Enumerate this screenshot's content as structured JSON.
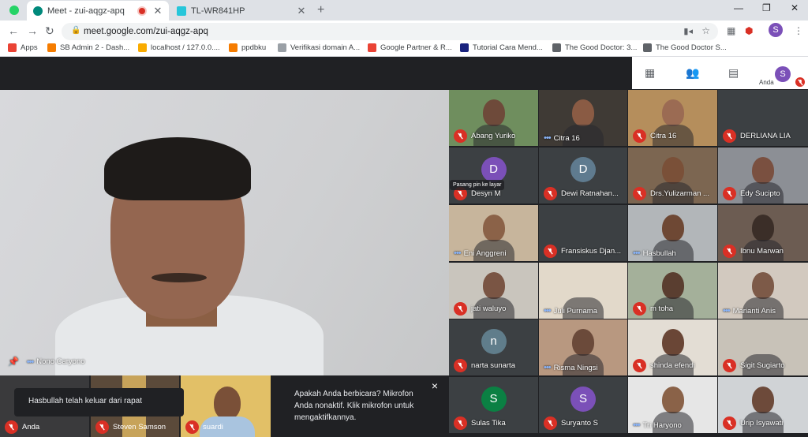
{
  "tabs": [
    {
      "title": "Meet - zui-aqgz-apq",
      "active": true,
      "favicon": "#00897b"
    },
    {
      "title": "TL-WR841HP",
      "active": false,
      "favicon": "#26c6da"
    }
  ],
  "address": {
    "url": "meet.google.com/zui-aqgz-apq"
  },
  "profile_initial": "S",
  "bookmarks": [
    {
      "label": "Apps",
      "color": "#ea4335"
    },
    {
      "label": "SB Admin 2 - Dash...",
      "color": "#f57c00"
    },
    {
      "label": "localhost / 127.0.0....",
      "color": "#f9ab00"
    },
    {
      "label": "ppdbku",
      "color": "#f57c00"
    },
    {
      "label": "Verifikasi domain A...",
      "color": "#9aa0a6"
    },
    {
      "label": "Google Partner & R...",
      "color": "#ea4335"
    },
    {
      "label": "Tutorial Cara Mend...",
      "color": "#1a237e"
    },
    {
      "label": "The Good Doctor: 3...",
      "color": "#5f6368"
    },
    {
      "label": "The Good Doctor S...",
      "color": "#5f6368"
    }
  ],
  "panel": {
    "participant_count": "30",
    "self_label": "Anda",
    "self_initial": "S"
  },
  "main": {
    "name": "Nono Caryono"
  },
  "tiles": [
    {
      "name": "Abang Yuriko",
      "muted": true
    },
    {
      "name": "Citra 16",
      "muted": false
    },
    {
      "name": "Citra 16",
      "muted": true
    },
    {
      "name": "DERLIANA LIA",
      "muted": true
    },
    {
      "name": "Desyn M",
      "muted": true,
      "initial": "D"
    },
    {
      "name": "Dewi Ratnahan...",
      "muted": true,
      "initial": "D"
    },
    {
      "name": "Drs.Yulizarman ...",
      "muted": true
    },
    {
      "name": "Edy Sucipto",
      "muted": true
    },
    {
      "name": "Eni Anggreni",
      "muted": false
    },
    {
      "name": "Fransiskus Djan...",
      "muted": true
    },
    {
      "name": "Hasbullah",
      "muted": false
    },
    {
      "name": "Ibnu Marwan",
      "muted": true
    },
    {
      "name": "jati waluyo",
      "muted": true
    },
    {
      "name": "Juli Purnama",
      "muted": false
    },
    {
      "name": "m toha",
      "muted": true
    },
    {
      "name": "Marianti Anis",
      "muted": false
    },
    {
      "name": "narta sunarta",
      "muted": true,
      "initial": "n"
    },
    {
      "name": "Risma Ningsi",
      "muted": false
    },
    {
      "name": "shinda efendi",
      "muted": true
    },
    {
      "name": "Sigit Sugiarto",
      "muted": true
    },
    {
      "name": "Sulas Tika",
      "muted": true,
      "initial": "S"
    },
    {
      "name": "Suryanto S",
      "muted": true,
      "initial": "S"
    },
    {
      "name": "Tri Haryono",
      "muted": false
    },
    {
      "name": "Urip Isyawati",
      "muted": true
    }
  ],
  "bottom": [
    {
      "name": "Anda"
    },
    {
      "name": "Steven Samson"
    },
    {
      "name": "suardi"
    }
  ],
  "pin_tooltip": "Pasang pin ke layar",
  "toast_left": "Hasbullah telah keluar dari rapat",
  "toast_mic": "Apakah Anda berbicara? Mikrofon Anda nonaktif. Klik mikrofon untuk mengaktifkannya.",
  "toast_close": "×"
}
